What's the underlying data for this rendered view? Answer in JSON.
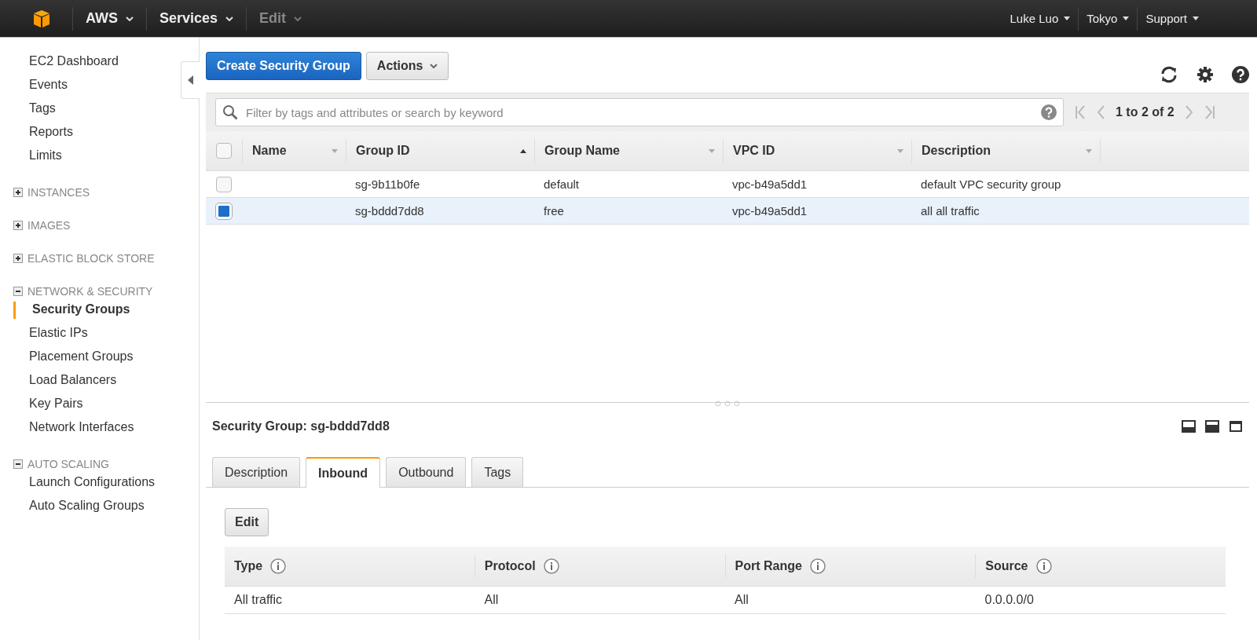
{
  "top_nav": {
    "left": [
      {
        "label": "AWS",
        "disabled": false
      },
      {
        "label": "Services",
        "disabled": false
      },
      {
        "label": "Edit",
        "disabled": true
      }
    ],
    "right": [
      "Luke Luo",
      "Tokyo",
      "Support"
    ]
  },
  "sidebar": {
    "items": [
      "EC2 Dashboard",
      "Events",
      "Tags",
      "Reports",
      "Limits"
    ],
    "sections": [
      {
        "label": "INSTANCES",
        "expanded": false
      },
      {
        "label": "IMAGES",
        "expanded": false
      },
      {
        "label": "ELASTIC BLOCK STORE",
        "expanded": false
      },
      {
        "label": "NETWORK & SECURITY",
        "expanded": true,
        "children": [
          {
            "label": "Security Groups",
            "selected": true
          },
          {
            "label": "Elastic IPs",
            "selected": false
          },
          {
            "label": "Placement Groups",
            "selected": false
          },
          {
            "label": "Load Balancers",
            "selected": false
          },
          {
            "label": "Key Pairs",
            "selected": false
          },
          {
            "label": "Network Interfaces",
            "selected": false
          }
        ]
      },
      {
        "label": "AUTO SCALING",
        "expanded": true,
        "children": [
          {
            "label": "Launch Configurations",
            "selected": false
          },
          {
            "label": "Auto Scaling Groups",
            "selected": false
          }
        ]
      }
    ]
  },
  "toolbar": {
    "primary": "Create Security Group",
    "actions": "Actions"
  },
  "search": {
    "placeholder": "Filter by tags and attributes or search by keyword"
  },
  "pagination": "1 to 2 of 2",
  "table": {
    "all_checked": false,
    "columns": [
      {
        "label": "Name",
        "sorted": false
      },
      {
        "label": "Group ID",
        "sorted": true
      },
      {
        "label": "Group Name",
        "sorted": false
      },
      {
        "label": "VPC ID",
        "sorted": false
      },
      {
        "label": "Description",
        "sorted": false
      }
    ],
    "rows": [
      {
        "selected": false,
        "cells": [
          "",
          "sg-9b11b0fe",
          "default",
          "vpc-b49a5dd1",
          "default VPC security group"
        ]
      },
      {
        "selected": true,
        "cells": [
          "",
          "sg-bddd7dd8",
          "free",
          "vpc-b49a5dd1",
          "all all traffic"
        ]
      }
    ]
  },
  "detail": {
    "title": "Security Group: sg-bddd7dd8",
    "tabs": [
      {
        "label": "Description",
        "selected": false
      },
      {
        "label": "Inbound",
        "selected": true
      },
      {
        "label": "Outbound",
        "selected": false
      },
      {
        "label": "Tags",
        "selected": false
      }
    ],
    "edit_button": "Edit",
    "rules": {
      "columns": [
        "Type",
        "Protocol",
        "Port Range",
        "Source"
      ],
      "rows": [
        [
          "All traffic",
          "All",
          "All",
          "0.0.0.0/0"
        ]
      ]
    }
  }
}
